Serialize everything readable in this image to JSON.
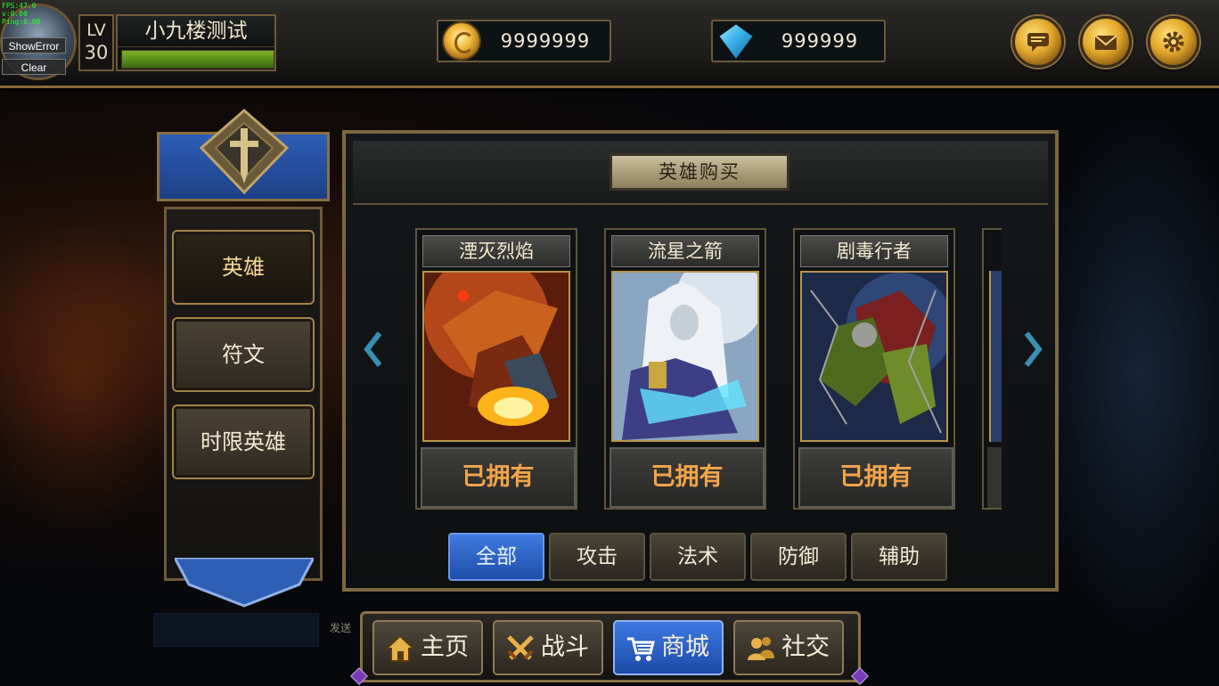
{
  "debug": {
    "lines": [
      "FPS:47.0",
      "v:0.00",
      "Ping:0.00"
    ],
    "show_error": "ShowError",
    "clear": "Clear"
  },
  "player": {
    "lv_label": "LV",
    "level": "30",
    "name": "小九楼测试",
    "xp_fraction": 1.0
  },
  "currency": {
    "gold": "9999999",
    "diamond": "999999"
  },
  "top_buttons": [
    "chat-bubble-icon",
    "mail-icon",
    "gear-icon"
  ],
  "left_menu": {
    "items": [
      {
        "label": "英雄",
        "active": true
      },
      {
        "label": "符文",
        "active": false
      },
      {
        "label": "时限英雄",
        "active": false
      }
    ]
  },
  "shop": {
    "title": "英雄购买",
    "cards": [
      {
        "name": "湮灭烈焰",
        "status": "已拥有"
      },
      {
        "name": "流星之箭",
        "status": "已拥有"
      },
      {
        "name": "剧毒行者",
        "status": "已拥有"
      }
    ],
    "filter_tabs": [
      {
        "label": "全部",
        "active": true
      },
      {
        "label": "攻击",
        "active": false
      },
      {
        "label": "法术",
        "active": false
      },
      {
        "label": "防御",
        "active": false
      },
      {
        "label": "辅助",
        "active": false
      }
    ]
  },
  "chat": {
    "input_value": "",
    "send_label": "发送"
  },
  "bottom_nav": [
    {
      "label": "主页",
      "icon": "home-icon",
      "active": false
    },
    {
      "label": "战斗",
      "icon": "crossed-swords-icon",
      "active": false
    },
    {
      "label": "商城",
      "icon": "shopping-cart-icon",
      "active": true
    },
    {
      "label": "社交",
      "icon": "friends-icon",
      "active": false
    }
  ],
  "colors": {
    "gold_trim": "#8a6a34",
    "active_blue": "#2f63c8",
    "owned_text": "#f3a44a"
  }
}
